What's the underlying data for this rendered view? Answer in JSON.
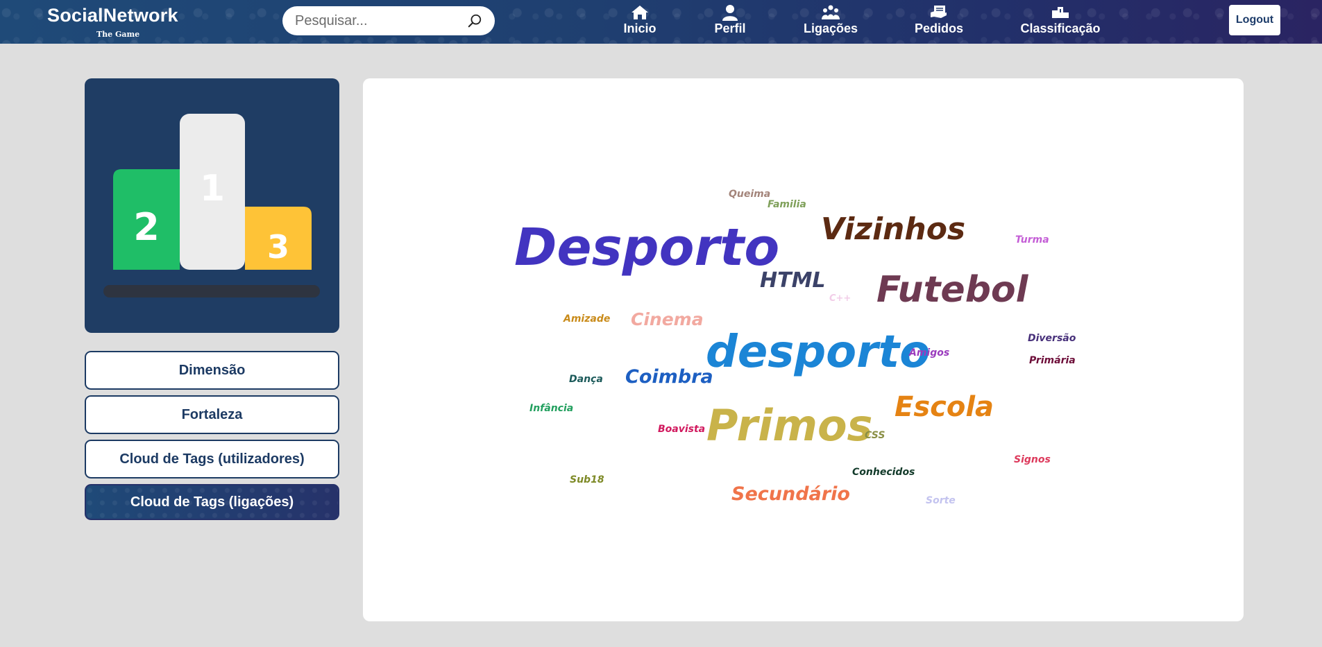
{
  "brand": {
    "title": "SocialNetwork",
    "subtitle": "The Game"
  },
  "search": {
    "placeholder": "Pesquisar..."
  },
  "nav": {
    "items": [
      {
        "label": "Inicio",
        "icon": "home-icon"
      },
      {
        "label": "Perfil",
        "icon": "user-icon"
      },
      {
        "label": "Ligações",
        "icon": "users-icon"
      },
      {
        "label": "Pedidos",
        "icon": "requests-icon"
      },
      {
        "label": "Classificação",
        "icon": "podium-icon"
      }
    ],
    "logout": "Logout"
  },
  "podium": {
    "first": "1",
    "second": "2",
    "third": "3"
  },
  "sidebar": {
    "buttons": [
      {
        "label": "Dimensão"
      },
      {
        "label": "Fortaleza"
      },
      {
        "label": "Cloud de Tags (utilizadores)"
      },
      {
        "label": "Cloud de Tags (ligações)",
        "active": true
      }
    ]
  },
  "tag_cloud": {
    "tags": [
      {
        "text": "Queima",
        "color": "#a3847a"
      },
      {
        "text": "Familia",
        "color": "#7fa05a"
      },
      {
        "text": "Vizinhos",
        "color": "#5c2a12"
      },
      {
        "text": "Turma",
        "color": "#c45ed6"
      },
      {
        "text": "Desporto",
        "color": "#4234c0"
      },
      {
        "text": "HTML",
        "color": "#3b4268"
      },
      {
        "text": "C++",
        "color": "#f2cde8"
      },
      {
        "text": "Futebol",
        "color": "#6e3a52"
      },
      {
        "text": "Amizade",
        "color": "#c98b1a"
      },
      {
        "text": "Cinema",
        "color": "#f2a9a0"
      },
      {
        "text": "Diversão",
        "color": "#47307a"
      },
      {
        "text": "desporto",
        "color": "#1b85d6"
      },
      {
        "text": "Amigos",
        "color": "#9a3bbd"
      },
      {
        "text": "Primária",
        "color": "#6e0f3a"
      },
      {
        "text": "Dança",
        "color": "#1c5a5a"
      },
      {
        "text": "Coimbra",
        "color": "#1d5fc2"
      },
      {
        "text": "Infância",
        "color": "#23a05f"
      },
      {
        "text": "Escola",
        "color": "#e58313"
      },
      {
        "text": "Boavista",
        "color": "#d1195e"
      },
      {
        "text": "Primos",
        "color": "#c9b34a"
      },
      {
        "text": "CSS",
        "color": "#8a8f45"
      },
      {
        "text": "Signos",
        "color": "#dd3a5c"
      },
      {
        "text": "Conhecidos",
        "color": "#123a2a"
      },
      {
        "text": "Sub18",
        "color": "#7e8a27"
      },
      {
        "text": "Secundário",
        "color": "#f0744a"
      },
      {
        "text": "Sorte",
        "color": "#c3c3ef"
      }
    ]
  }
}
